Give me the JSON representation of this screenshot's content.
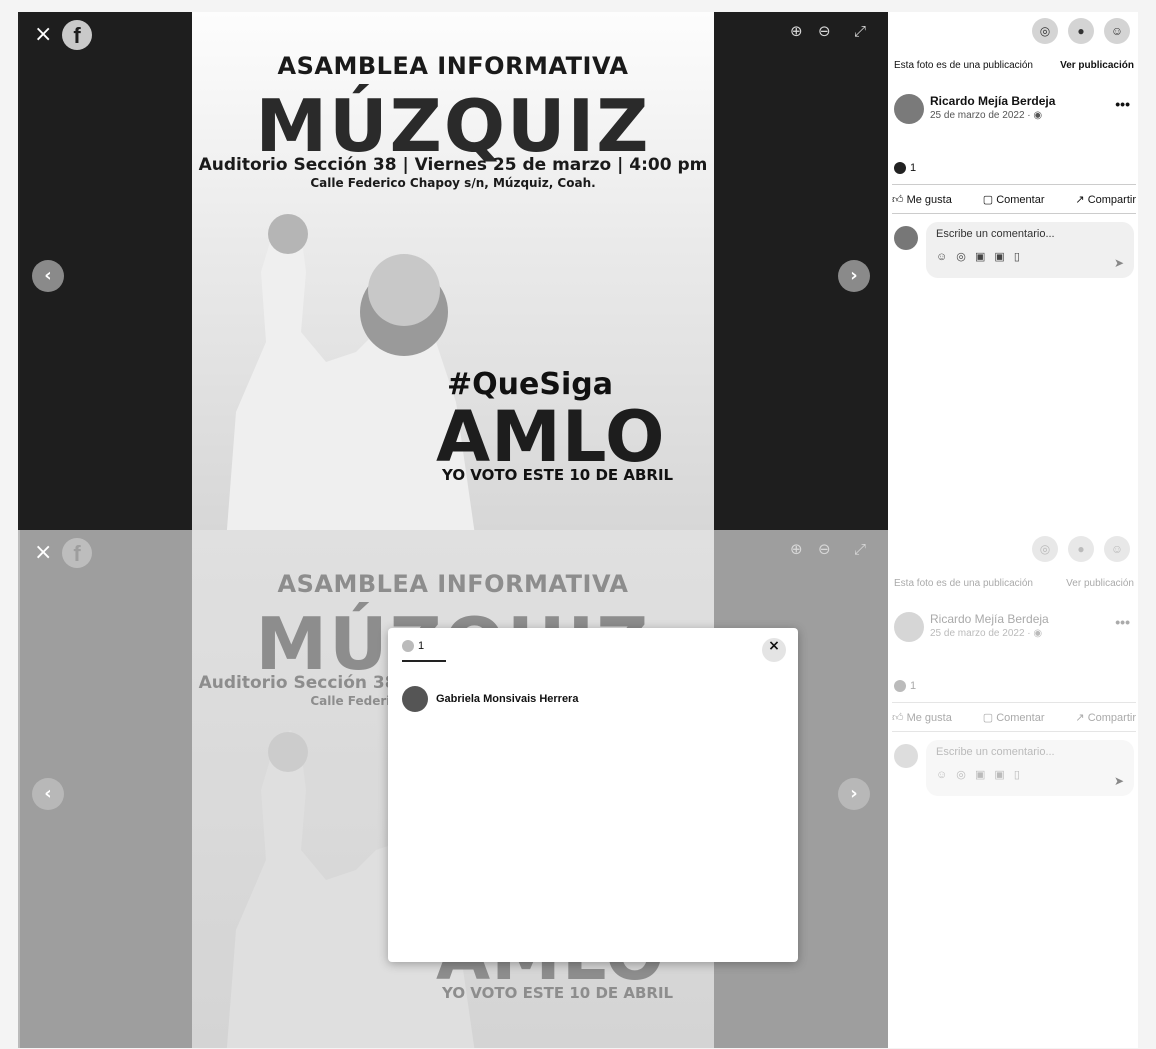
{
  "poster": {
    "heading": "ASAMBLEA INFORMATIVA",
    "town": "MÚZQUIZ",
    "details": "Auditorio Sección 38 | Viernes 25 de marzo | 4:00 pm",
    "address": "Calle Federico Chapoy s/n, Múzquiz, Coah.",
    "hashtag": "#QueSiga",
    "name": "AMLO",
    "vote": "YO VOTO ESTE 10 DE ABRIL"
  },
  "viewer": {
    "close": "×",
    "logo": "f",
    "zoom_in": "⊕",
    "zoom_out": "⊖",
    "fullscreen": "⤢",
    "prev": "‹",
    "next": "›"
  },
  "side": {
    "notice": "Esta foto es de una publicación",
    "view_post": "Ver publicación",
    "author": "Ricardo Mejía Berdeja",
    "date": "25 de marzo de 2022 · ",
    "more": "•••",
    "reaction_count": "1",
    "like": "Me gusta",
    "comment": "Comentar",
    "share": "Compartir",
    "comment_placeholder": "Escribe un comentario...",
    "comment_icons": "☺ ◎ ▣ ▣ ▯",
    "send": "➤"
  },
  "side_faded": {
    "author": "Ricardo Mejía Berdeja",
    "date": "25 de marzo de 2022 · "
  },
  "modal": {
    "tab_count": "1",
    "close": "×",
    "reactor": "Gabriela Monsivais Herrera"
  }
}
